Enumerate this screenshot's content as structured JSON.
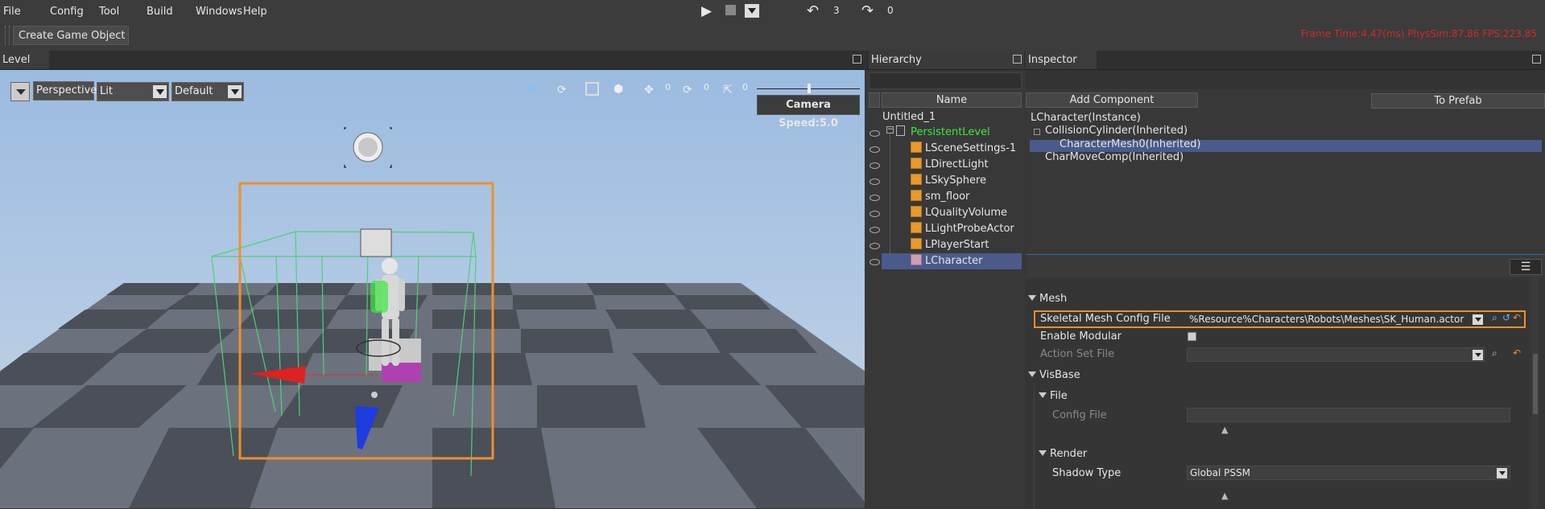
{
  "menu": [
    "File",
    "Config",
    "Tool",
    "Build",
    "Windows",
    "Help"
  ],
  "playback": {
    "undo_count": "3",
    "redo_count": "0"
  },
  "toolbar": {
    "create_game_object": "Create Game Object"
  },
  "stats": "Frame Time:4.47(ms)  PhysSim:87.86  FPS:223.85",
  "panels": {
    "level": "Level",
    "hierarchy": "Hierarchy",
    "inspector": "Inspector"
  },
  "viewport": {
    "view_mode": "Perspective",
    "lighting": "Lit",
    "preset": "Default",
    "camera_speed": "Camera Speed:5.0",
    "gizmo_counts": [
      "0",
      "0",
      "0"
    ]
  },
  "hierarchy": {
    "column": "Name",
    "scene": "Untitled_1",
    "level": "PersistentLevel",
    "items": [
      "LSceneSettings-1",
      "LDirectLight",
      "LSkySphere",
      "sm_floor",
      "LQualityVolume",
      "LLightProbeActor",
      "LPlayerStart",
      "LCharacter"
    ]
  },
  "inspector": {
    "add_component": "Add Component",
    "to_prefab": "To Prefab",
    "components": [
      "LCharacter(Instance)",
      "CollisionCylinder(Inherited)",
      "CharacterMesh0(Inherited)",
      "CharMoveComp(Inherited)"
    ],
    "sections": {
      "mesh": "Mesh",
      "skeletal_label": "Skeletal Mesh Config File",
      "skeletal_value": "%Resource%Characters\\Robots\\Meshes\\SK_Human.actor",
      "enable_modular": "Enable Modular",
      "action_set": "Action Set File",
      "visbase": "VisBase",
      "file": "File",
      "config_file": "Config File",
      "render": "Render",
      "shadow_type": "Shadow Type",
      "shadow_value": "Global PSSM"
    }
  },
  "colors": {
    "accent_orange": "#ef8f2b",
    "selection_blue": "#4a5a8a",
    "level_green": "#3ee83e",
    "stats_red": "#d02a2a"
  }
}
